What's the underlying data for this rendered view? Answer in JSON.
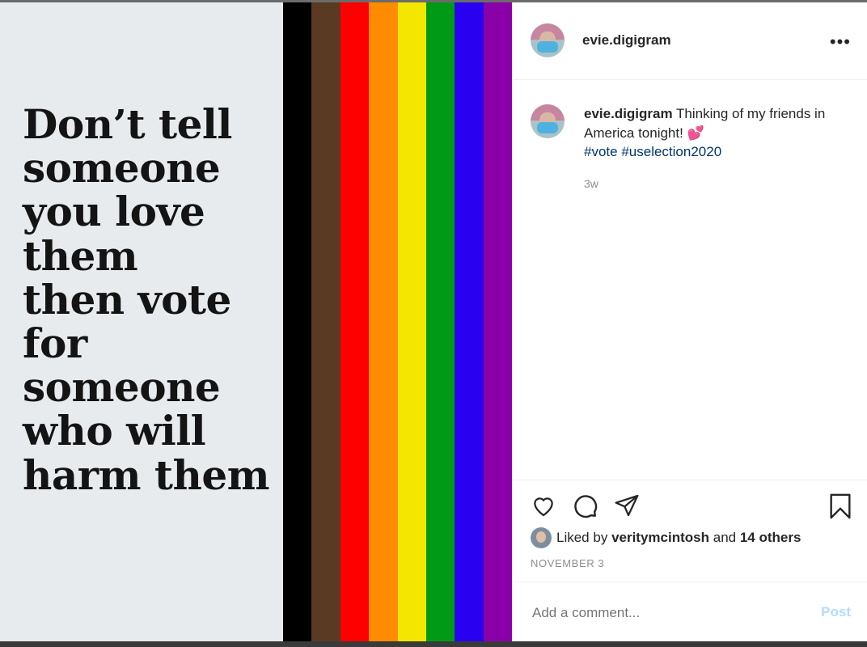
{
  "post_image": {
    "quote_lines": "Don’t tell\nsomeone\nyou love\nthem\nthen vote\nfor\nsomeone\nwho will\nharm them",
    "flag_colors": [
      "#000000",
      "#5a3a22",
      "#ff0000",
      "#ff8c00",
      "#f5e600",
      "#009a17",
      "#2a00f0",
      "#8a00a8"
    ]
  },
  "header": {
    "username": "evie.digigram",
    "more_icon": "more-horizontal-icon"
  },
  "caption": {
    "username": "evie.digigram",
    "text": "Thinking of my friends in America tonight!",
    "emoji": "💕",
    "hashtag_1": "#vote",
    "hashtag_2": "#uselection2020",
    "time": "3w"
  },
  "actions": {
    "like_icon": "heart-icon",
    "comment_icon": "comment-icon",
    "share_icon": "paper-plane-icon",
    "save_icon": "bookmark-icon"
  },
  "likes": {
    "prefix": "Liked by",
    "user": "veritymcintosh",
    "and": "and",
    "others": "14 others"
  },
  "date": "NOVEMBER 3",
  "comment": {
    "placeholder": "Add a comment...",
    "post_label": "Post"
  }
}
